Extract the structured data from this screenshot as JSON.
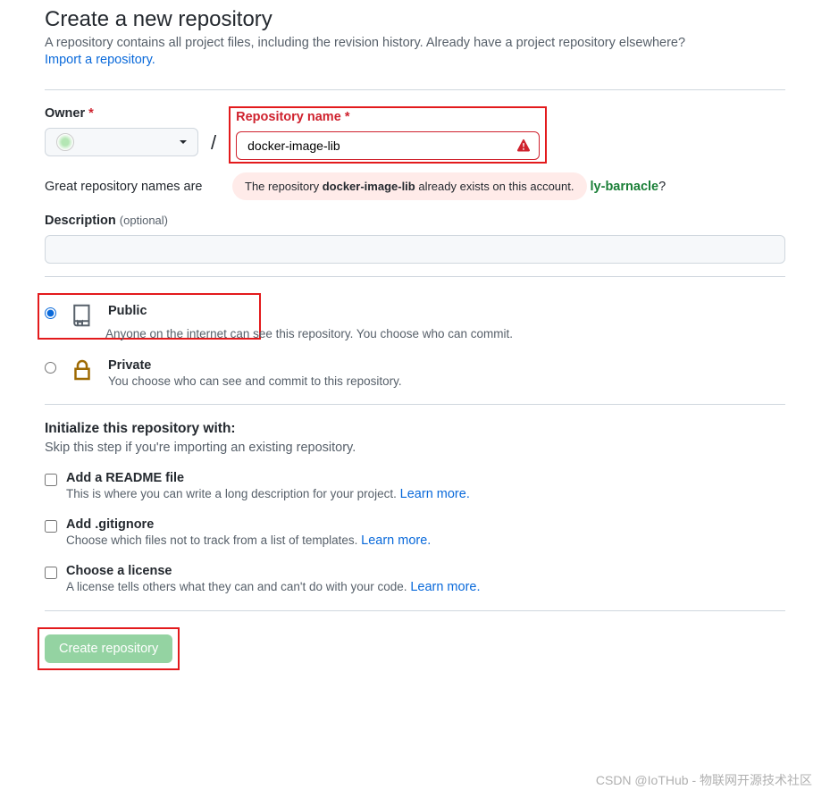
{
  "header": {
    "title": "Create a new repository",
    "subtitle_part1": "A repository contains all project files, including the revision history. Already have a project repository elsewhere?",
    "import_link": "Import a repository."
  },
  "form": {
    "owner_label": "Owner",
    "repo_label": "Repository name",
    "repo_value": "docker-image-lib",
    "name_hint_prefix": "Great repository names are",
    "name_hint_suffix_visible": "ly-barnacle",
    "name_hint_question": "?",
    "tooltip_prefix": "The repository ",
    "tooltip_repo": "docker-image-lib",
    "tooltip_suffix": " already exists on this account.",
    "desc_label": "Description",
    "desc_optional": "(optional)"
  },
  "visibility": {
    "public": {
      "title": "Public",
      "desc": "Anyone on the internet can see this repository. You choose who can commit."
    },
    "private": {
      "title": "Private",
      "desc": "You choose who can see and commit to this repository."
    }
  },
  "initialize": {
    "heading": "Initialize this repository with:",
    "subheading": "Skip this step if you're importing an existing repository.",
    "readme": {
      "title": "Add a README file",
      "desc": "This is where you can write a long description for your project. ",
      "learn": "Learn more."
    },
    "gitignore": {
      "title": "Add .gitignore",
      "desc": "Choose which files not to track from a list of templates. ",
      "learn": "Learn more."
    },
    "license": {
      "title": "Choose a license",
      "desc": "A license tells others what they can and can't do with your code. ",
      "learn": "Learn more."
    }
  },
  "submit_label": "Create repository",
  "watermark": "CSDN @IoTHub - 物联网开源技术社区"
}
